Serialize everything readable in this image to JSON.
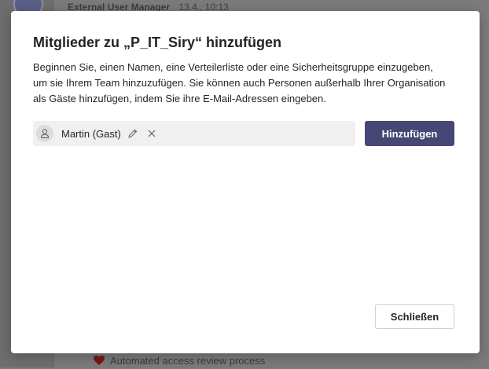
{
  "background": {
    "message_author": "External User Manager",
    "message_time": "13.4., 10:13",
    "bottom_message": "Automated access review process",
    "heart_icon": "heart-icon",
    "heart_color": "#8b1a1a"
  },
  "dialog": {
    "title": "Mitglieder zu „P_IT_Siry“ hinzufügen",
    "description": "Beginnen Sie, einen Namen, eine Verteilerliste oder eine Sicherheitsgruppe einzugeben, um sie Ihrem Team hinzuzufügen. Sie können auch Personen außerhalb Ihrer Organisation als Gäste hinzufügen, indem Sie ihre E-Mail-Adressen eingeben.",
    "selected_member": {
      "label": "Martin (Gast)",
      "avatar_icon": "person-icon",
      "edit_icon": "pencil-icon",
      "remove_icon": "close-icon"
    },
    "add_button_label": "Hinzufügen",
    "close_button_label": "Schließen",
    "accent_color": "#464775"
  }
}
